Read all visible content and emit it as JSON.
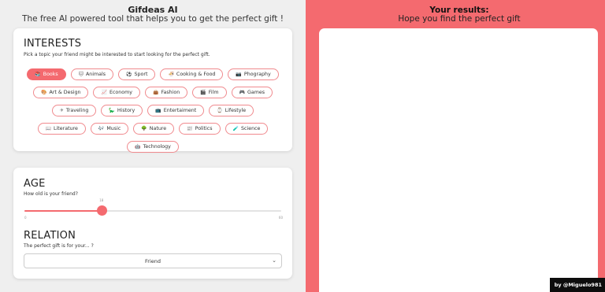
{
  "header": {
    "title": "Gifdeas AI",
    "subtitle": "The free AI powered tool that helps you to get the perfect gift !"
  },
  "interests": {
    "title": "INTERESTS",
    "subtitle": "Pick a topic your friend might be interested to start looking for the perfect gift.",
    "selected": "Books",
    "rows": [
      [
        {
          "label": "Books",
          "icon": "📚",
          "icon_name": "books-icon",
          "active": true
        },
        {
          "label": "Animals",
          "icon": "🐱",
          "icon_name": "cat-icon"
        },
        {
          "label": "Sport",
          "icon": "⚽",
          "icon_name": "soccer-ball-icon"
        },
        {
          "label": "Cooking & Food",
          "icon": "🍜",
          "icon_name": "bowl-icon"
        },
        {
          "label": "Phography",
          "icon": "📷",
          "icon_name": "camera-icon"
        }
      ],
      [
        {
          "label": "Art & Design",
          "icon": "🎨",
          "icon_name": "palette-icon"
        },
        {
          "label": "Economy",
          "icon": "📈",
          "icon_name": "chart-icon"
        },
        {
          "label": "Fashion",
          "icon": "👜",
          "icon_name": "handbag-icon"
        },
        {
          "label": "Film",
          "icon": "🎬",
          "icon_name": "clapper-icon"
        },
        {
          "label": "Games",
          "icon": "🎮",
          "icon_name": "gamepad-icon"
        }
      ],
      [
        {
          "label": "Traveling",
          "icon": "✈",
          "icon_name": "airplane-icon"
        },
        {
          "label": "History",
          "icon": "🦕",
          "icon_name": "dinosaur-icon"
        },
        {
          "label": "Entertaiment",
          "icon": "📺",
          "icon_name": "tv-icon"
        },
        {
          "label": "Lifestyle",
          "icon": "⌚",
          "icon_name": "watch-icon"
        }
      ],
      [
        {
          "label": "Literature",
          "icon": "📖",
          "icon_name": "open-book-icon"
        },
        {
          "label": "Music",
          "icon": "🎶",
          "icon_name": "music-notes-icon"
        },
        {
          "label": "Nature",
          "icon": "🌳",
          "icon_name": "tree-icon"
        },
        {
          "label": "Politics",
          "icon": "📰",
          "icon_name": "newspaper-icon"
        },
        {
          "label": "Science",
          "icon": "🧪",
          "icon_name": "test-tube-icon"
        }
      ],
      [
        {
          "label": "Technology",
          "icon": "🤖",
          "icon_name": "robot-icon"
        }
      ]
    ]
  },
  "age": {
    "title": "AGE",
    "subtitle": "How old is your friend?",
    "value": "18",
    "min": "0",
    "max": "60"
  },
  "relation": {
    "title": "RELATION",
    "subtitle": "The perfect gift is for your... ?",
    "selected": "Friend"
  },
  "results": {
    "title": "Your results:",
    "subtitle": "Hope you find the perfect gift"
  },
  "credit": "by @Miguelo981",
  "colors": {
    "accent": "#f46a6f",
    "background": "#efefef",
    "card": "#ffffff"
  }
}
